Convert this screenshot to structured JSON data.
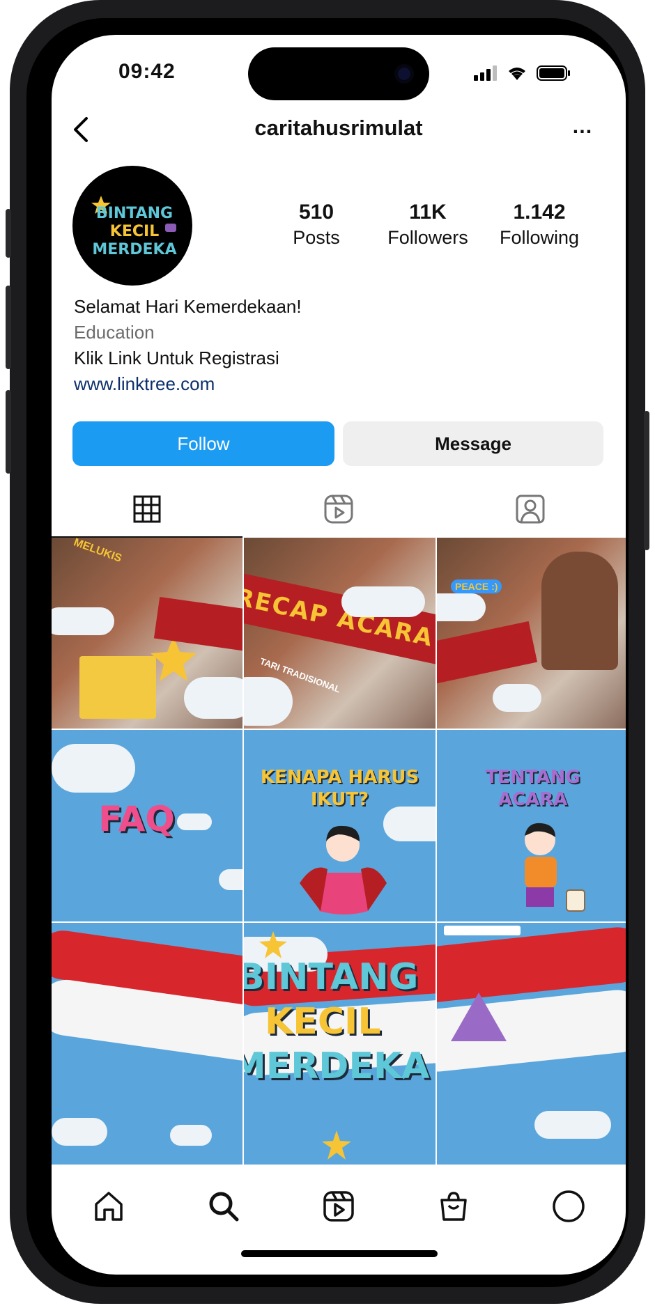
{
  "status": {
    "time": "09:42"
  },
  "header": {
    "username": "caritahusrimulat",
    "more": "…"
  },
  "profile": {
    "avatar_text": [
      "BINTANG",
      "KECIL",
      "MERDEKA"
    ],
    "stats": [
      {
        "value": "510",
        "label": "Posts"
      },
      {
        "value": "11K",
        "label": "Followers"
      },
      {
        "value": "1.142",
        "label": "Following"
      }
    ],
    "bio": {
      "line1": "Selamat Hari Kemerdekaan!",
      "category": "Education",
      "line2": "Klik Link Untuk Registrasi",
      "link": "www.linktree.com"
    }
  },
  "actions": {
    "follow": "Follow",
    "message": "Message"
  },
  "tabs": [
    {
      "icon": "grid-icon",
      "active": true
    },
    {
      "icon": "reels-icon",
      "active": false
    },
    {
      "icon": "tagged-icon",
      "active": false
    }
  ],
  "posts": {
    "recap": {
      "title": "RECAP ACARA",
      "tag1": "MELUKIS",
      "tag2": "PEACE :)",
      "tag3": "TARI TRADISIONAL"
    },
    "faq": "FAQ",
    "kenapa": [
      "KENAPA HARUS",
      "IKUT?"
    ],
    "tentang": [
      "TENTANG",
      "ACARA"
    ],
    "poster": [
      "BINTANG",
      "KECIL",
      "MERDEKA"
    ]
  },
  "bottom_nav": [
    "home-icon",
    "search-icon",
    "reels-icon",
    "shop-icon",
    "profile-icon"
  ],
  "colors": {
    "follow_blue": "#1c9bf2",
    "sky": "#5aa6dc",
    "red": "#d8262d",
    "yellow": "#f6c435",
    "pink": "#ee4f8c",
    "teal": "#5ec7d8",
    "purple": "#8b5bb5"
  }
}
